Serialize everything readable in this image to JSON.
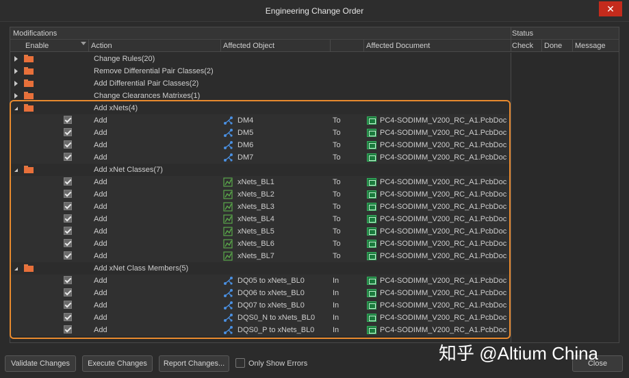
{
  "window": {
    "title": "Engineering Change Order",
    "close_glyph": "✕"
  },
  "group_headers": {
    "modifications": "Modifications",
    "status": "Status"
  },
  "columns": {
    "enable": "Enable",
    "action": "Action",
    "affected_object": "Affected Object",
    "affected_document": "Affected Document",
    "check": "Check",
    "done": "Done",
    "message": "Message"
  },
  "groups": [
    {
      "label": "Change Rules(20)",
      "expanded": false
    },
    {
      "label": "Remove Differential Pair Classes(2)",
      "expanded": false
    },
    {
      "label": "Add Differential Pair Classes(2)",
      "expanded": false
    },
    {
      "label": "Change Clearances Matrixes(1)",
      "expanded": false
    },
    {
      "label": "Add xNets(4)",
      "expanded": true
    },
    {
      "label": "Add xNet Classes(7)",
      "expanded": true
    },
    {
      "label": "Add xNet Class Members(5)",
      "expanded": true
    }
  ],
  "items": {
    "xnets": [
      {
        "action": "Add",
        "object": "DM4",
        "direction": "To",
        "document": "PC4-SODIMM_V200_RC_A1.PcbDoc"
      },
      {
        "action": "Add",
        "object": "DM5",
        "direction": "To",
        "document": "PC4-SODIMM_V200_RC_A1.PcbDoc"
      },
      {
        "action": "Add",
        "object": "DM6",
        "direction": "To",
        "document": "PC4-SODIMM_V200_RC_A1.PcbDoc"
      },
      {
        "action": "Add",
        "object": "DM7",
        "direction": "To",
        "document": "PC4-SODIMM_V200_RC_A1.PcbDoc"
      }
    ],
    "xnet_classes": [
      {
        "action": "Add",
        "object": "xNets_BL1",
        "direction": "To",
        "document": "PC4-SODIMM_V200_RC_A1.PcbDoc"
      },
      {
        "action": "Add",
        "object": "xNets_BL2",
        "direction": "To",
        "document": "PC4-SODIMM_V200_RC_A1.PcbDoc"
      },
      {
        "action": "Add",
        "object": "xNets_BL3",
        "direction": "To",
        "document": "PC4-SODIMM_V200_RC_A1.PcbDoc"
      },
      {
        "action": "Add",
        "object": "xNets_BL4",
        "direction": "To",
        "document": "PC4-SODIMM_V200_RC_A1.PcbDoc"
      },
      {
        "action": "Add",
        "object": "xNets_BL5",
        "direction": "To",
        "document": "PC4-SODIMM_V200_RC_A1.PcbDoc"
      },
      {
        "action": "Add",
        "object": "xNets_BL6",
        "direction": "To",
        "document": "PC4-SODIMM_V200_RC_A1.PcbDoc"
      },
      {
        "action": "Add",
        "object": "xNets_BL7",
        "direction": "To",
        "document": "PC4-SODIMM_V200_RC_A1.PcbDoc"
      }
    ],
    "xnet_class_members": [
      {
        "action": "Add",
        "object": "DQ05 to xNets_BL0",
        "direction": "In",
        "document": "PC4-SODIMM_V200_RC_A1.PcbDoc"
      },
      {
        "action": "Add",
        "object": "DQ06 to xNets_BL0",
        "direction": "In",
        "document": "PC4-SODIMM_V200_RC_A1.PcbDoc"
      },
      {
        "action": "Add",
        "object": "DQ07 to xNets_BL0",
        "direction": "In",
        "document": "PC4-SODIMM_V200_RC_A1.PcbDoc"
      },
      {
        "action": "Add",
        "object": "DQS0_N to xNets_BL0",
        "direction": "In",
        "document": "PC4-SODIMM_V200_RC_A1.PcbDoc"
      },
      {
        "action": "Add",
        "object": "DQS0_P to xNets_BL0",
        "direction": "In",
        "document": "PC4-SODIMM_V200_RC_A1.PcbDoc"
      }
    ]
  },
  "buttons": {
    "validate": "Validate Changes",
    "execute": "Execute Changes",
    "report": "Report Changes...",
    "close": "Close"
  },
  "only_show_errors": {
    "label": "Only Show Errors",
    "checked": false
  },
  "watermark": "知乎 @Altium China",
  "colors": {
    "highlight": "#e98a2e",
    "folder": "#e8703a",
    "xnet_icon": "#4a90e2",
    "class_icon": "#5aa84a",
    "doc_icon": "#1a7a3c"
  },
  "icons": {
    "folder": "folder-icon",
    "xnet": "xnet-icon",
    "class": "net-class-icon",
    "document": "pcb-document-icon",
    "checkbox": "checkbox-checked-icon"
  }
}
